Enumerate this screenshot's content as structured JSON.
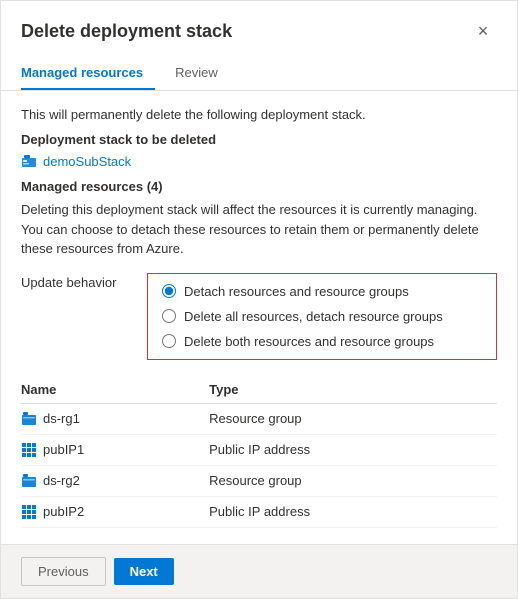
{
  "dialog": {
    "title": "Delete deployment stack",
    "close_label": "×"
  },
  "tabs": [
    {
      "label": "Managed resources",
      "id": "managed-resources",
      "active": true
    },
    {
      "label": "Review",
      "id": "review",
      "active": false
    }
  ],
  "body": {
    "intro_text": "This will permanently delete the following deployment stack.",
    "deployment_stack_label": "Deployment stack to be deleted",
    "stack_name": "demoSubStack",
    "managed_resources_label": "Managed resources (4)",
    "warning_text": "Deleting this deployment stack will affect the resources it is currently managing. You can choose to detach these resources to retain them or permanently delete these resources from Azure.",
    "update_behavior_label": "Update behavior",
    "radio_options": [
      {
        "id": "opt1",
        "label": "Detach resources and resource groups",
        "checked": true
      },
      {
        "id": "opt2",
        "label": "Delete all resources, detach resource groups",
        "checked": false
      },
      {
        "id": "opt3",
        "label": "Delete both resources and resource groups",
        "checked": false
      }
    ],
    "table": {
      "columns": [
        "Name",
        "Type"
      ],
      "rows": [
        {
          "icon": "rg",
          "name": "ds-rg1",
          "type": "Resource group"
        },
        {
          "icon": "pip",
          "name": "pubIP1",
          "type": "Public IP address"
        },
        {
          "icon": "rg",
          "name": "ds-rg2",
          "type": "Resource group"
        },
        {
          "icon": "pip",
          "name": "pubIP2",
          "type": "Public IP address"
        }
      ]
    }
  },
  "footer": {
    "previous_label": "Previous",
    "next_label": "Next"
  }
}
